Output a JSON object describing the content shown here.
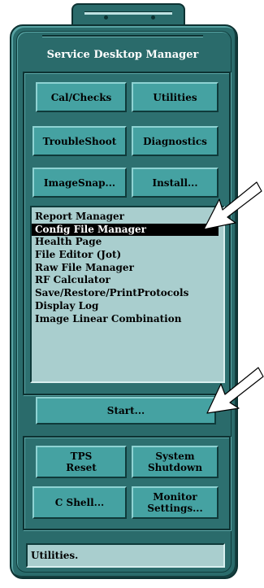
{
  "window": {
    "title": "Service Desktop Manager"
  },
  "tools": {
    "cal_checks": "Cal/Checks",
    "utilities": "Utilities",
    "troubleshoot": "TroubleShoot",
    "diagnostics": "Diagnostics",
    "imagesnap": "ImageSnap...",
    "install": "Install..."
  },
  "list": {
    "items": [
      "Report Manager",
      "Config File Manager",
      "Health Page",
      "File Editor (Jot)",
      "Raw File Manager",
      "RF Calculator",
      "Save/Restore/PrintProtocols",
      "Display Log",
      "Image Linear Combination"
    ],
    "selected_index": 1
  },
  "start_label": "Start...",
  "system": {
    "tps_reset": "TPS\nReset",
    "system_shutdown": "System\nShutdown",
    "c_shell": "C Shell...",
    "monitor_settings": "Monitor\nSettings..."
  },
  "status_text": "Utilities.",
  "colors": {
    "panel": "#2a6b6b",
    "button": "#45a2a2",
    "list_background": "#a9cece",
    "selection": "#000000"
  }
}
